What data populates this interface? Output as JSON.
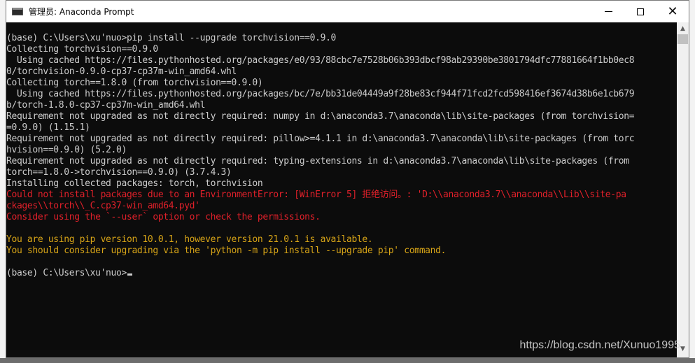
{
  "window": {
    "title": "管理员: Anaconda Prompt",
    "controls": {
      "minimize": "minimize",
      "maximize": "maximize",
      "close": "close"
    }
  },
  "console": {
    "lines": [
      {
        "text": "(base) C:\\Users\\xu'nuo>pip install --upgrade torchvision==0.9.0",
        "style": "normal"
      },
      {
        "text": "Collecting torchvision==0.9.0",
        "style": "normal"
      },
      {
        "text": "  Using cached https://files.pythonhosted.org/packages/e0/93/88cbc7e7528b06b393dbcf98ab29390be3801794dfc77881664f1bb0ec8",
        "style": "normal"
      },
      {
        "text": "0/torchvision-0.9.0-cp37-cp37m-win_amd64.whl",
        "style": "normal"
      },
      {
        "text": "Collecting torch==1.8.0 (from torchvision==0.9.0)",
        "style": "normal"
      },
      {
        "text": "  Using cached https://files.pythonhosted.org/packages/bc/7e/bb31de04449a9f28be83cf944f71fcd2fcd598416ef3674d38b6e1cb679",
        "style": "normal"
      },
      {
        "text": "b/torch-1.8.0-cp37-cp37m-win_amd64.whl",
        "style": "normal"
      },
      {
        "text": "Requirement not upgraded as not directly required: numpy in d:\\anaconda3.7\\anaconda\\lib\\site-packages (from torchvision=",
        "style": "normal"
      },
      {
        "text": "=0.9.0) (1.15.1)",
        "style": "normal"
      },
      {
        "text": "Requirement not upgraded as not directly required: pillow>=4.1.1 in d:\\anaconda3.7\\anaconda\\lib\\site-packages (from torc",
        "style": "normal"
      },
      {
        "text": "hvision==0.9.0) (5.2.0)",
        "style": "normal"
      },
      {
        "text": "Requirement not upgraded as not directly required: typing-extensions in d:\\anaconda3.7\\anaconda\\lib\\site-packages (from ",
        "style": "normal"
      },
      {
        "text": "torch==1.8.0->torchvision==0.9.0) (3.7.4.3)",
        "style": "normal"
      },
      {
        "text": "Installing collected packages: torch, torchvision",
        "style": "normal"
      },
      {
        "text": "Could not install packages due to an EnvironmentError: [WinError 5] 拒绝访问。: 'D:\\\\anaconda3.7\\\\anaconda\\\\Lib\\\\site-pa",
        "style": "err"
      },
      {
        "text": "ckages\\\\torch\\\\_C.cp37-win_amd64.pyd'",
        "style": "err"
      },
      {
        "text": "Consider using the `--user` option or check the permissions.",
        "style": "err"
      },
      {
        "text": "",
        "style": "normal"
      },
      {
        "text": "You are using pip version 10.0.1, however version 21.0.1 is available.",
        "style": "warn"
      },
      {
        "text": "You should consider upgrading via the 'python -m pip install --upgrade pip' command.",
        "style": "warn"
      },
      {
        "text": "",
        "style": "normal"
      },
      {
        "text": "(base) C:\\Users\\xu'nuo>",
        "style": "normal",
        "cursor": true
      }
    ]
  },
  "watermark": "https://blog.csdn.net/Xunuo1995",
  "colors": {
    "console_bg": "#0c0c0c",
    "text": "#cccccc",
    "error": "#e0202a",
    "warning": "#d7a417"
  }
}
